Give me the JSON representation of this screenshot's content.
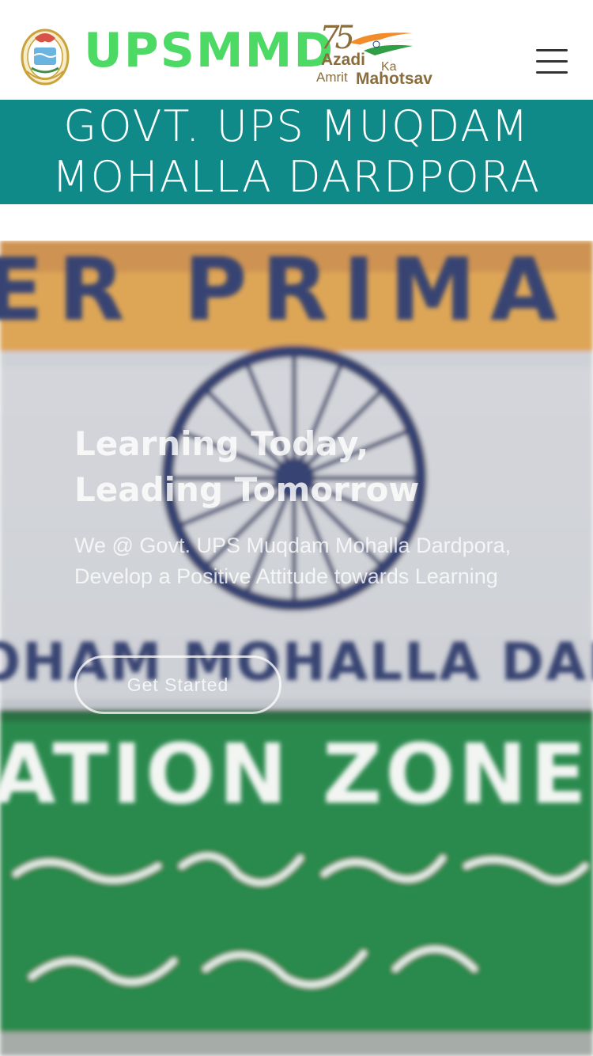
{
  "header": {
    "brand": "UPSMMD",
    "campaign_logo": {
      "number": "75",
      "line1": "Azadi",
      "line1_suffix": "Ka",
      "line2_prefix": "Amrit",
      "line2": "Mahotsav"
    },
    "menu_icon": "hamburger-icon",
    "emblem_icon": "state-emblem"
  },
  "title_band": {
    "title": "GOVT. UPS MUQDAM MOHALLA DARDPORA"
  },
  "hero": {
    "title_line1": "Learning Today,",
    "title_line2": "Leading Tomorrow",
    "subtitle": "We @ Govt. UPS Muqdam Mohalla Dardpora, Develop a Positive Attitude towards Learning",
    "cta_label": "Get Started",
    "background_signboard": {
      "top_text": "ER PRIMA",
      "middle_text": "OHAM MOHALLA DARDPO",
      "lower_text": "ATION ZONE KRAL"
    }
  },
  "colors": {
    "brand_green": "#4cd964",
    "band_teal": "#108a89",
    "campaign_brown": "#8a6d3b",
    "sign_green": "#0e7a36",
    "sign_orange": "#d99a3f"
  }
}
